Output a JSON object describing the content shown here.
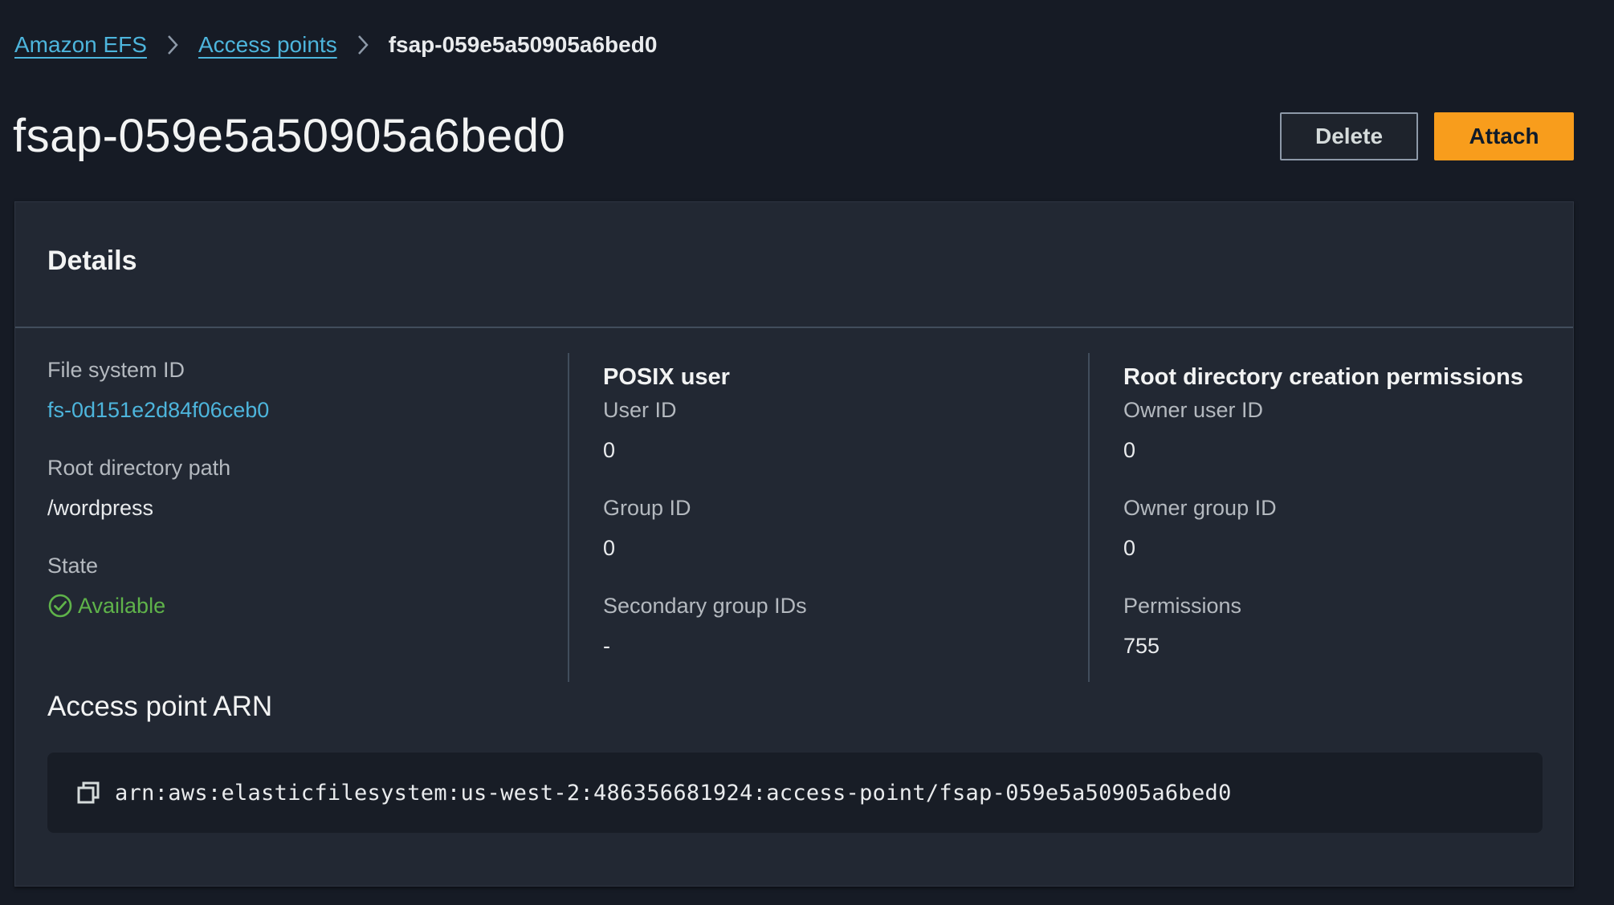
{
  "breadcrumb": {
    "items": [
      {
        "label": "Amazon EFS"
      },
      {
        "label": "Access points"
      }
    ],
    "current": "fsap-059e5a50905a6bed0"
  },
  "header": {
    "title": "fsap-059e5a50905a6bed0",
    "delete_label": "Delete",
    "attach_label": "Attach"
  },
  "details": {
    "title": "Details",
    "file_system_id_label": "File system ID",
    "file_system_id_value": "fs-0d151e2d84f06ceb0",
    "root_path_label": "Root directory path",
    "root_path_value": "/wordpress",
    "state_label": "State",
    "state_value": "Available",
    "posix_heading": "POSIX user",
    "user_id_label": "User ID",
    "user_id_value": "0",
    "group_id_label": "Group ID",
    "group_id_value": "0",
    "secondary_label": "Secondary group IDs",
    "secondary_value": "-",
    "perms_heading": "Root directory creation permissions",
    "owner_uid_label": "Owner user ID",
    "owner_uid_value": "0",
    "owner_gid_label": "Owner group ID",
    "owner_gid_value": "0",
    "permissions_label": "Permissions",
    "permissions_value": "755",
    "arn_title": "Access point ARN",
    "arn_value": "arn:aws:elasticfilesystem:us-west-2:486356681924:access-point/fsap-059e5a50905a6bed0"
  },
  "colors": {
    "background": "#161b25",
    "panel": "#222833",
    "link": "#4db5dc",
    "primary_button": "#f89d1c",
    "status_success": "#5fb34a"
  },
  "icons": [
    "chevron-right-icon",
    "check-circle-icon",
    "copy-icon"
  ]
}
